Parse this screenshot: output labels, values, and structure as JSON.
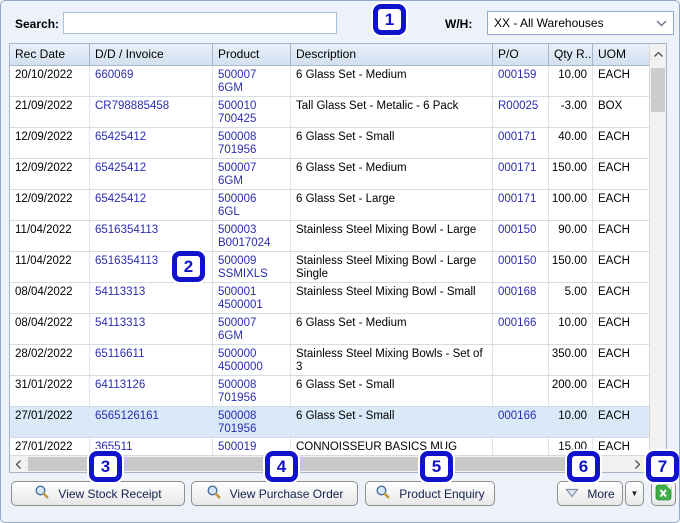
{
  "topbar": {
    "search_label": "Search:",
    "search_value": "",
    "wh_label": "W/H:",
    "wh_value": "XX - All Warehouses"
  },
  "table": {
    "columns": [
      "Rec Date",
      "D/D / Invoice",
      "Product",
      "Description",
      "P/O",
      "Qty R...",
      "UOM"
    ],
    "rows": [
      {
        "date": "20/10/2022",
        "invoice": "660069",
        "product_code": "500007",
        "product_ref": "6GM",
        "description": "6 Glass Set - Medium",
        "po": "000159",
        "qty": "10.00",
        "uom": "EACH",
        "selected": false
      },
      {
        "date": "21/09/2022",
        "invoice": "CR798885458",
        "product_code": "500010",
        "product_ref": "700425",
        "description": "Tall Glass Set - Metalic - 6 Pack",
        "po": "R00025",
        "qty": "-3.00",
        "uom": "BOX",
        "selected": false
      },
      {
        "date": "12/09/2022",
        "invoice": "65425412",
        "product_code": "500008",
        "product_ref": "701956",
        "description": "6 Glass Set - Small",
        "po": "000171",
        "qty": "40.00",
        "uom": "EACH",
        "selected": false
      },
      {
        "date": "12/09/2022",
        "invoice": "65425412",
        "product_code": "500007",
        "product_ref": "6GM",
        "description": "6 Glass Set - Medium",
        "po": "000171",
        "qty": "150.00",
        "uom": "EACH",
        "selected": false
      },
      {
        "date": "12/09/2022",
        "invoice": "65425412",
        "product_code": "500006",
        "product_ref": "6GL",
        "description": "6 Glass Set - Large",
        "po": "000171",
        "qty": "100.00",
        "uom": "EACH",
        "selected": false
      },
      {
        "date": "11/04/2022",
        "invoice": "6516354113",
        "product_code": "500003",
        "product_ref": "B0017024",
        "description": "Stainless Steel Mixing Bowl - Large",
        "po": "000150",
        "qty": "90.00",
        "uom": "EACH",
        "selected": false
      },
      {
        "date": "11/04/2022",
        "invoice": "6516354113",
        "product_code": "500009",
        "product_ref": "SSMIXLS",
        "description": "Stainless Steel Mixing Bowl - Large Single",
        "po": "000150",
        "qty": "150.00",
        "uom": "EACH",
        "selected": false
      },
      {
        "date": "08/04/2022",
        "invoice": "54113313",
        "product_code": "500001",
        "product_ref": "4500001",
        "description": "Stainless Steel Mixing Bowl - Small",
        "po": "000168",
        "qty": "5.00",
        "uom": "EACH",
        "selected": false
      },
      {
        "date": "08/04/2022",
        "invoice": "54113313",
        "product_code": "500007",
        "product_ref": "6GM",
        "description": "6 Glass Set - Medium",
        "po": "000166",
        "qty": "10.00",
        "uom": "EACH",
        "selected": false
      },
      {
        "date": "28/02/2022",
        "invoice": "65116611",
        "product_code": "500000",
        "product_ref": "4500000",
        "description": "Stainless Steel Mixing Bowls - Set of 3",
        "po": "",
        "qty": "350.00",
        "uom": "EACH",
        "selected": false
      },
      {
        "date": "31/01/2022",
        "invoice": "64113126",
        "product_code": "500008",
        "product_ref": "701956",
        "description": "6 Glass Set - Small",
        "po": "",
        "qty": "200.00",
        "uom": "EACH",
        "selected": false
      },
      {
        "date": "27/01/2022",
        "invoice": "6565126161",
        "product_code": "500008",
        "product_ref": "701956",
        "description": "6 Glass Set - Small",
        "po": "000166",
        "qty": "10.00",
        "uom": "EACH",
        "selected": true
      },
      {
        "date": "27/01/2022",
        "invoice": "365511",
        "product_code": "500019",
        "product_ref": "",
        "description": "CONNOISSEUR BASICS MUG",
        "po": "",
        "qty": "15.00",
        "uom": "EACH",
        "selected": false
      }
    ]
  },
  "buttons": {
    "view_stock_receipt": "View Stock Receipt",
    "view_purchase_order": "View Purchase Order",
    "product_enquiry": "Product Enquiry",
    "more": "More"
  },
  "icons": {
    "search_buttons": "magnifier",
    "more_button": "triangle-down-outline",
    "more_split": "triangle-down-small",
    "export_button": "excel-spreadsheet",
    "warehouse_dropdown": "chevron-down",
    "vscroll": "chevron-up",
    "hscroll": "chevron-left"
  },
  "badges": [
    "1",
    "2",
    "3",
    "4",
    "5",
    "6",
    "7"
  ],
  "colors": {
    "link_blue": "#2b2bb4",
    "badge_blue": "#1113cc",
    "selected_row": "#d9e9f8",
    "window_bg": "#edf1fa",
    "excel_green": "#3fae49"
  }
}
